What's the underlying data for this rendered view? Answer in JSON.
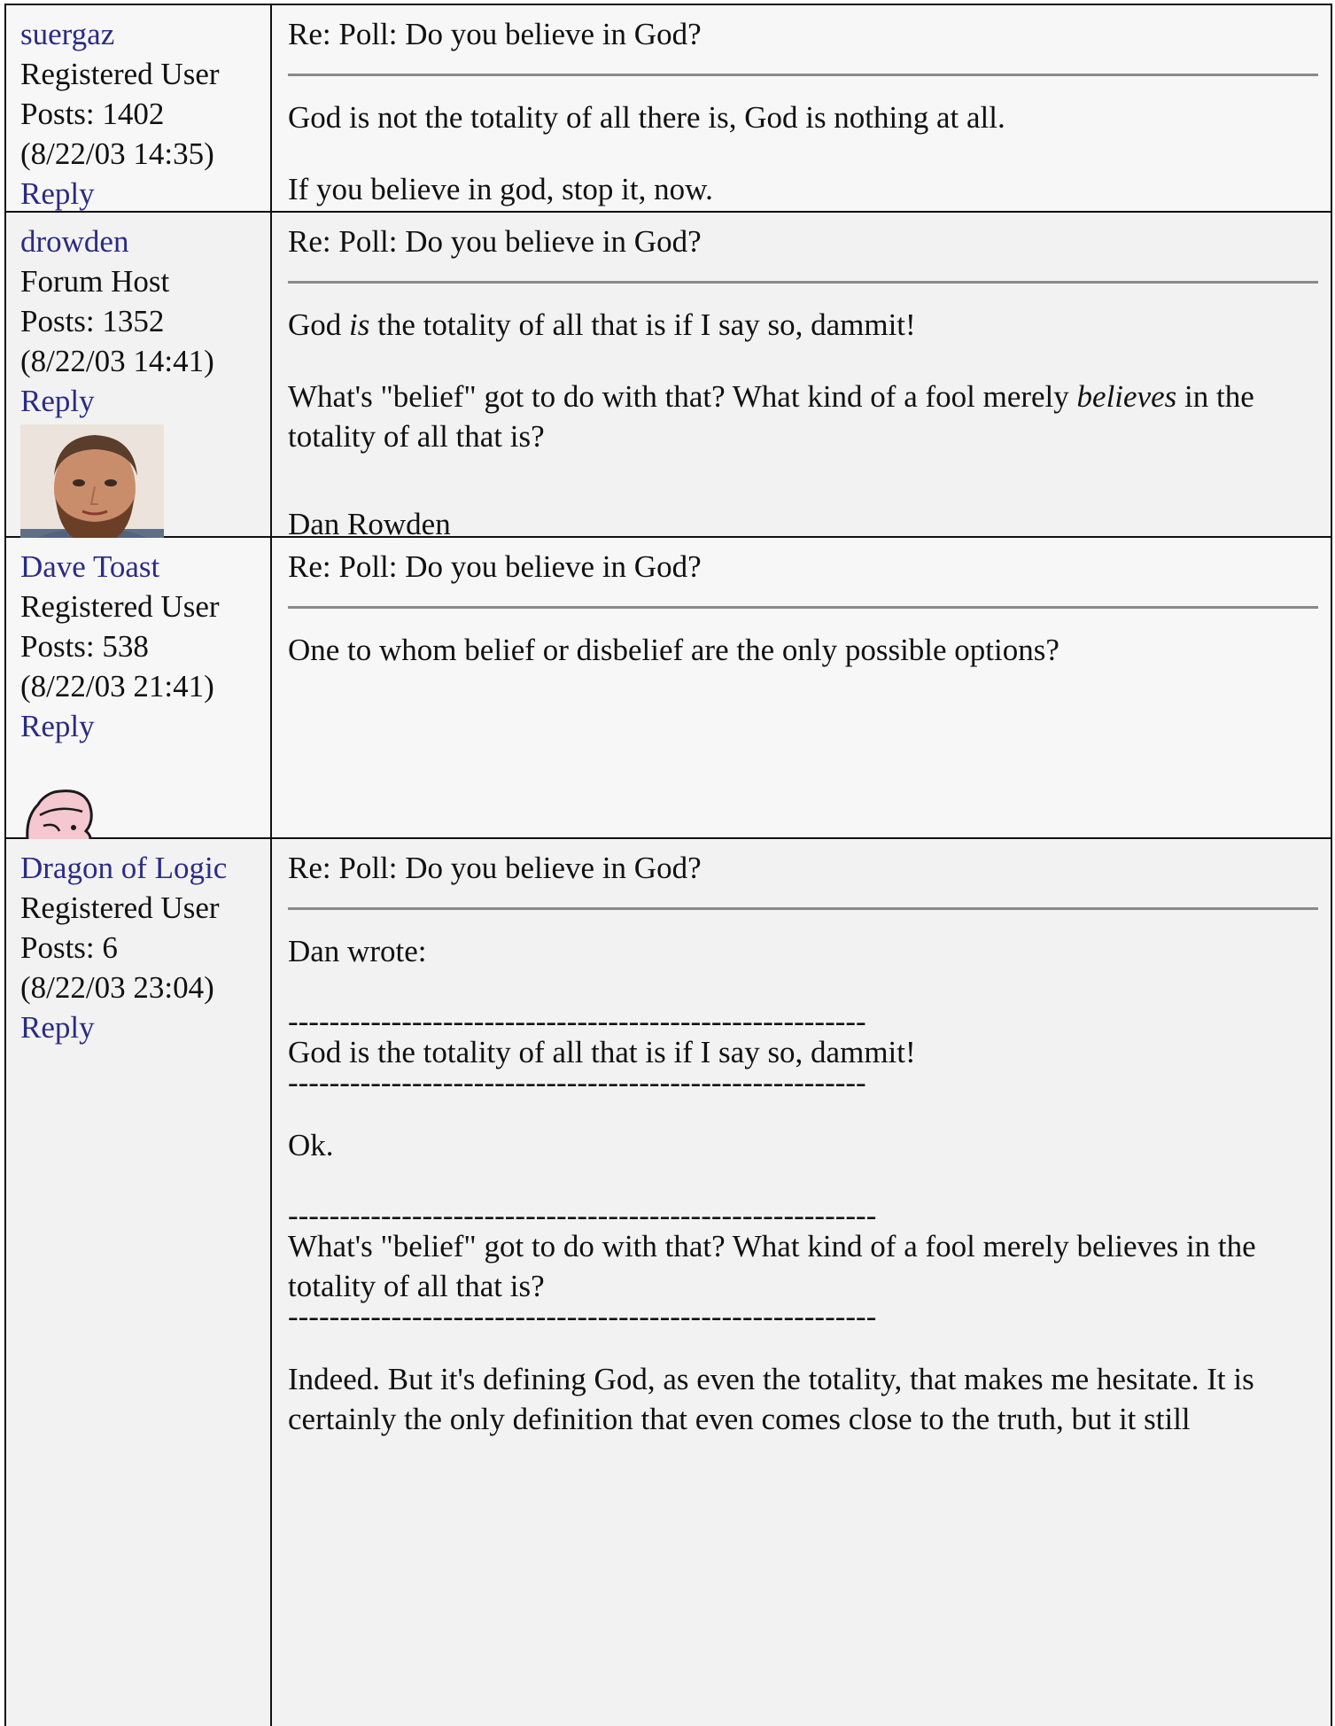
{
  "posts": [
    {
      "username": "suergaz",
      "role": "Registered User",
      "posts_label": "Posts: 1402",
      "datetime": "(8/22/03 14:35)",
      "reply": "Reply",
      "subject": "Re: Poll: Do you believe in God?",
      "body": [
        "God is not the totality of all there is, God is nothing at all.",
        "If you believe in god, stop it, now."
      ]
    },
    {
      "username": "drowden",
      "role": "Forum Host",
      "posts_label": "Posts: 1352",
      "datetime": "(8/22/03 14:41)",
      "reply": "Reply",
      "avatar": "bearded-man-photo",
      "subject": "Re: Poll: Do you believe in God?",
      "body_p1_a": "God ",
      "body_p1_em": "is",
      "body_p1_b": " the totality of all that is if I say so, dammit!",
      "body_p2_a": "What's \"belief\" got to do with that? What kind of a fool merely ",
      "body_p2_em": "believes",
      "body_p2_b": " in the totality of all that is?",
      "signature": "Dan Rowden"
    },
    {
      "username": "Dave Toast",
      "role": "Registered User",
      "posts_label": "Posts: 538",
      "datetime": "(8/22/03 21:41)",
      "reply": "Reply",
      "avatar": "cartoon-head",
      "subject": "Re: Poll: Do you believe in God?",
      "body": [
        "One to whom belief or disbelief are the only possible options?"
      ]
    },
    {
      "username": "Dragon of Logic",
      "role": "Registered User",
      "posts_label": "Posts: 6",
      "datetime": "(8/22/03 23:04)",
      "reply": "Reply",
      "subject": "Re: Poll: Do you believe in God?",
      "quote_intro": "Dan wrote:",
      "dash1": "--------------------------------------------------------",
      "quote1": "God is the totality of all that is if I say so, dammit!",
      "dash2": "--------------------------------------------------------",
      "reply1": "Ok.",
      "dash3": "---------------------------------------------------------",
      "quote2": "What's \"belief\" got to do with that? What kind of a fool merely believes in the totality of all that is?",
      "dash4": "---------------------------------------------------------",
      "reply2": "Indeed. But it's defining God, as even the totality, that makes me hesitate. It is certainly the only definition that even comes close to the truth, but it still"
    }
  ]
}
